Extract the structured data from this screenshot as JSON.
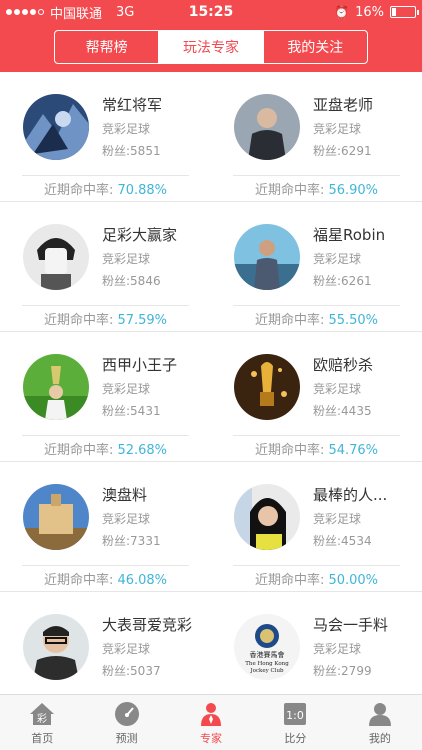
{
  "status": {
    "carrier": "中国联通",
    "network": "3G",
    "time": "15:25",
    "battery": "16%",
    "battery_level": 0.16
  },
  "tabs": {
    "items": [
      "帮帮榜",
      "玩法专家",
      "我的关注"
    ],
    "active": 1
  },
  "labels": {
    "rate_prefix": "近期命中率: ",
    "fans_prefix": "粉丝:"
  },
  "experts": [
    {
      "name": "常红将军",
      "type": "竞彩足球",
      "fans": "5851",
      "rate": "70.88%"
    },
    {
      "name": "亚盘老师",
      "type": "竞彩足球",
      "fans": "6291",
      "rate": "56.90%"
    },
    {
      "name": "足彩大赢家",
      "type": "竞彩足球",
      "fans": "5846",
      "rate": "57.59%"
    },
    {
      "name": "福星Robin",
      "type": "竞彩足球",
      "fans": "6261",
      "rate": "55.50%"
    },
    {
      "name": "西甲小王子",
      "type": "竞彩足球",
      "fans": "5431",
      "rate": "52.68%"
    },
    {
      "name": "欧赔秒杀",
      "type": "竞彩足球",
      "fans": "4435",
      "rate": "54.76%"
    },
    {
      "name": "澳盘料",
      "type": "竞彩足球",
      "fans": "7331",
      "rate": "46.08%"
    },
    {
      "name": "最棒的人...",
      "type": "竞彩足球",
      "fans": "4534",
      "rate": "50.00%"
    },
    {
      "name": "大表哥爱竞彩",
      "type": "竞彩足球",
      "fans": "5037",
      "rate": ""
    },
    {
      "name": "马会一手料",
      "type": "竞彩足球",
      "fans": "2799",
      "rate": ""
    }
  ],
  "avatar_logo": {
    "line1": "香港賽馬會",
    "line2": "The Hong Kong",
    "line3": "Jockey Club"
  },
  "bottom_tabs": [
    {
      "label": "首页",
      "icon": "home-icon",
      "glyph": "彩"
    },
    {
      "label": "预测",
      "icon": "gauge-icon"
    },
    {
      "label": "专家",
      "icon": "expert-icon"
    },
    {
      "label": "比分",
      "icon": "score-icon",
      "glyph": "1:0"
    },
    {
      "label": "我的",
      "icon": "user-icon"
    }
  ],
  "bottom_active": 2,
  "colors": {
    "accent": "#f24a4f",
    "rate": "#41b5d8"
  }
}
